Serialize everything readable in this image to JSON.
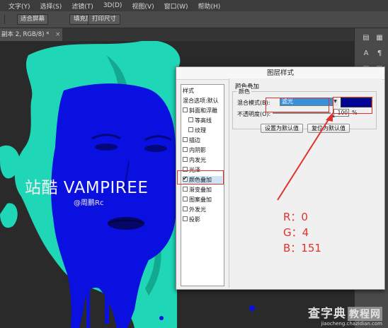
{
  "menubar": {
    "items": [
      "文字(Y)",
      "选择(S)",
      "滤镜(T)",
      "3D(D)",
      "视图(V)",
      "窗口(W)",
      "帮助(H)"
    ]
  },
  "options_bar": {
    "buttons": [
      "适合屏幕",
      "填充屏幕",
      "打印尺寸"
    ]
  },
  "document_tab": {
    "title": "副本 2, RGB/8) *",
    "close": "×"
  },
  "artwork": {
    "title": "站酷 VAMPIREE",
    "author": "@周鹏Rc"
  },
  "dialog": {
    "title": "图层样式",
    "style_list": {
      "header": "样式",
      "blend_options": "混合选项:默认",
      "items": [
        {
          "label": "斜面和浮雕",
          "checked": false,
          "indent": false,
          "selected": false
        },
        {
          "label": "等高线",
          "checked": false,
          "indent": true,
          "selected": false
        },
        {
          "label": "纹理",
          "checked": false,
          "indent": true,
          "selected": false
        },
        {
          "label": "描边",
          "checked": false,
          "indent": false,
          "selected": false
        },
        {
          "label": "内阴影",
          "checked": false,
          "indent": false,
          "selected": false
        },
        {
          "label": "内发光",
          "checked": false,
          "indent": false,
          "selected": false
        },
        {
          "label": "光泽",
          "checked": false,
          "indent": false,
          "selected": false
        },
        {
          "label": "颜色叠加",
          "checked": true,
          "indent": false,
          "selected": true
        },
        {
          "label": "渐变叠加",
          "checked": false,
          "indent": false,
          "selected": false
        },
        {
          "label": "图案叠加",
          "checked": false,
          "indent": false,
          "selected": false
        },
        {
          "label": "外发光",
          "checked": false,
          "indent": false,
          "selected": false
        },
        {
          "label": "投影",
          "checked": false,
          "indent": false,
          "selected": false
        }
      ]
    },
    "section_title": "颜色叠加",
    "group_legend": "颜色",
    "blend_mode_label": "混合模式(B):",
    "blend_mode_value": "滤光",
    "overlay_color": "#000497",
    "opacity_label": "不透明度(O):",
    "opacity_value": "100",
    "opacity_unit": "%",
    "buttons": {
      "set_default": "设置为默认值",
      "reset_default": "复位为默认值"
    }
  },
  "annotation": {
    "color": "#e0322c",
    "r": "R：0",
    "g": "G：4",
    "b": "B：151"
  },
  "watermark": {
    "main_left": "查字典",
    "main_box": "教程网",
    "url": "jiaocheng.chazidian.com"
  },
  "colors": {
    "teal": "#1fd6b6",
    "blue": "#0a10e0",
    "dialog_bg": "#f0f0f0"
  }
}
